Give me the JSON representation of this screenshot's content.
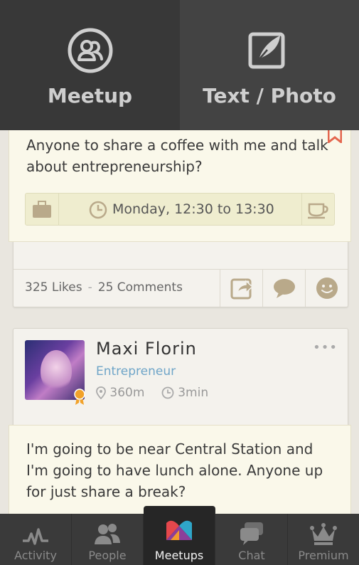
{
  "top_actions": {
    "meetup_label": "Meetup",
    "text_photo_label": "Text / Photo",
    "meetup_icon": "people-circle-icon",
    "text_photo_icon": "edit-feather-icon"
  },
  "posts": [
    {
      "text": "Anyone to share a coffee with me and talk about entrepreneurship?",
      "when": "Monday, 12:30 to 13:30",
      "likes_label": "325 Likes",
      "separator": "-",
      "comments_label": "25 Comments"
    },
    {
      "author": "Maxi Florin",
      "role": "Entrepreneur",
      "distance": "360m",
      "time_ago": "3min",
      "more": "•••",
      "text": "I'm going to be near Central Station and I'm going to have lunch alone. Anyone up for just share a break?"
    }
  ],
  "bottom_nav": [
    {
      "label": "Activity",
      "icon": "pulse-icon"
    },
    {
      "label": "People",
      "icon": "people-icon"
    },
    {
      "label": "Meetups",
      "icon": "meetups-logo-icon",
      "active": true
    },
    {
      "label": "Chat",
      "icon": "chat-bubbles-icon"
    },
    {
      "label": "Premium",
      "icon": "crown-icon"
    }
  ],
  "colors": {
    "accent_blue": "#6fa5c8",
    "bookmark_red": "#e4664e",
    "badge_orange": "#f2a22a"
  }
}
